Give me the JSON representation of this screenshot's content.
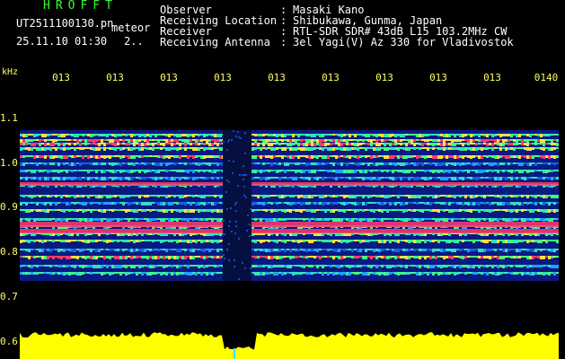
{
  "header": {
    "app_title": "HROFFT",
    "filename": "UT2511100130.pn",
    "meteor_label": "meteor",
    "datetime": "25.11.10 01:30",
    "page_count": "2..",
    "meta": [
      {
        "label": "Observer",
        "value": "Masaki Kano"
      },
      {
        "label": "Receiving Location",
        "value": "Shibukawa, Gunma, Japan"
      },
      {
        "label": "Receiver",
        "value": "RTL-SDR SDR# 43dB L15 103.2MHz CW"
      },
      {
        "label": "Receiving Antenna",
        "value": "3el Yagi(V) Az 330 for Vladivostok"
      }
    ]
  },
  "axes": {
    "y_unit": "kHz",
    "x_ticks": [
      "013",
      "013",
      "013",
      "013",
      "013",
      "013",
      "013",
      "013",
      "013",
      "0140"
    ],
    "y_ticks": [
      "1.1",
      "1.0",
      "0.9",
      "0.8",
      "0.7",
      "0.6"
    ]
  },
  "colors": {
    "label": "#33ff33",
    "value": "#ffffff",
    "axis": "#ffff66",
    "noise_floor": "#ffff00",
    "signal_band": "#ff3b6b"
  }
}
